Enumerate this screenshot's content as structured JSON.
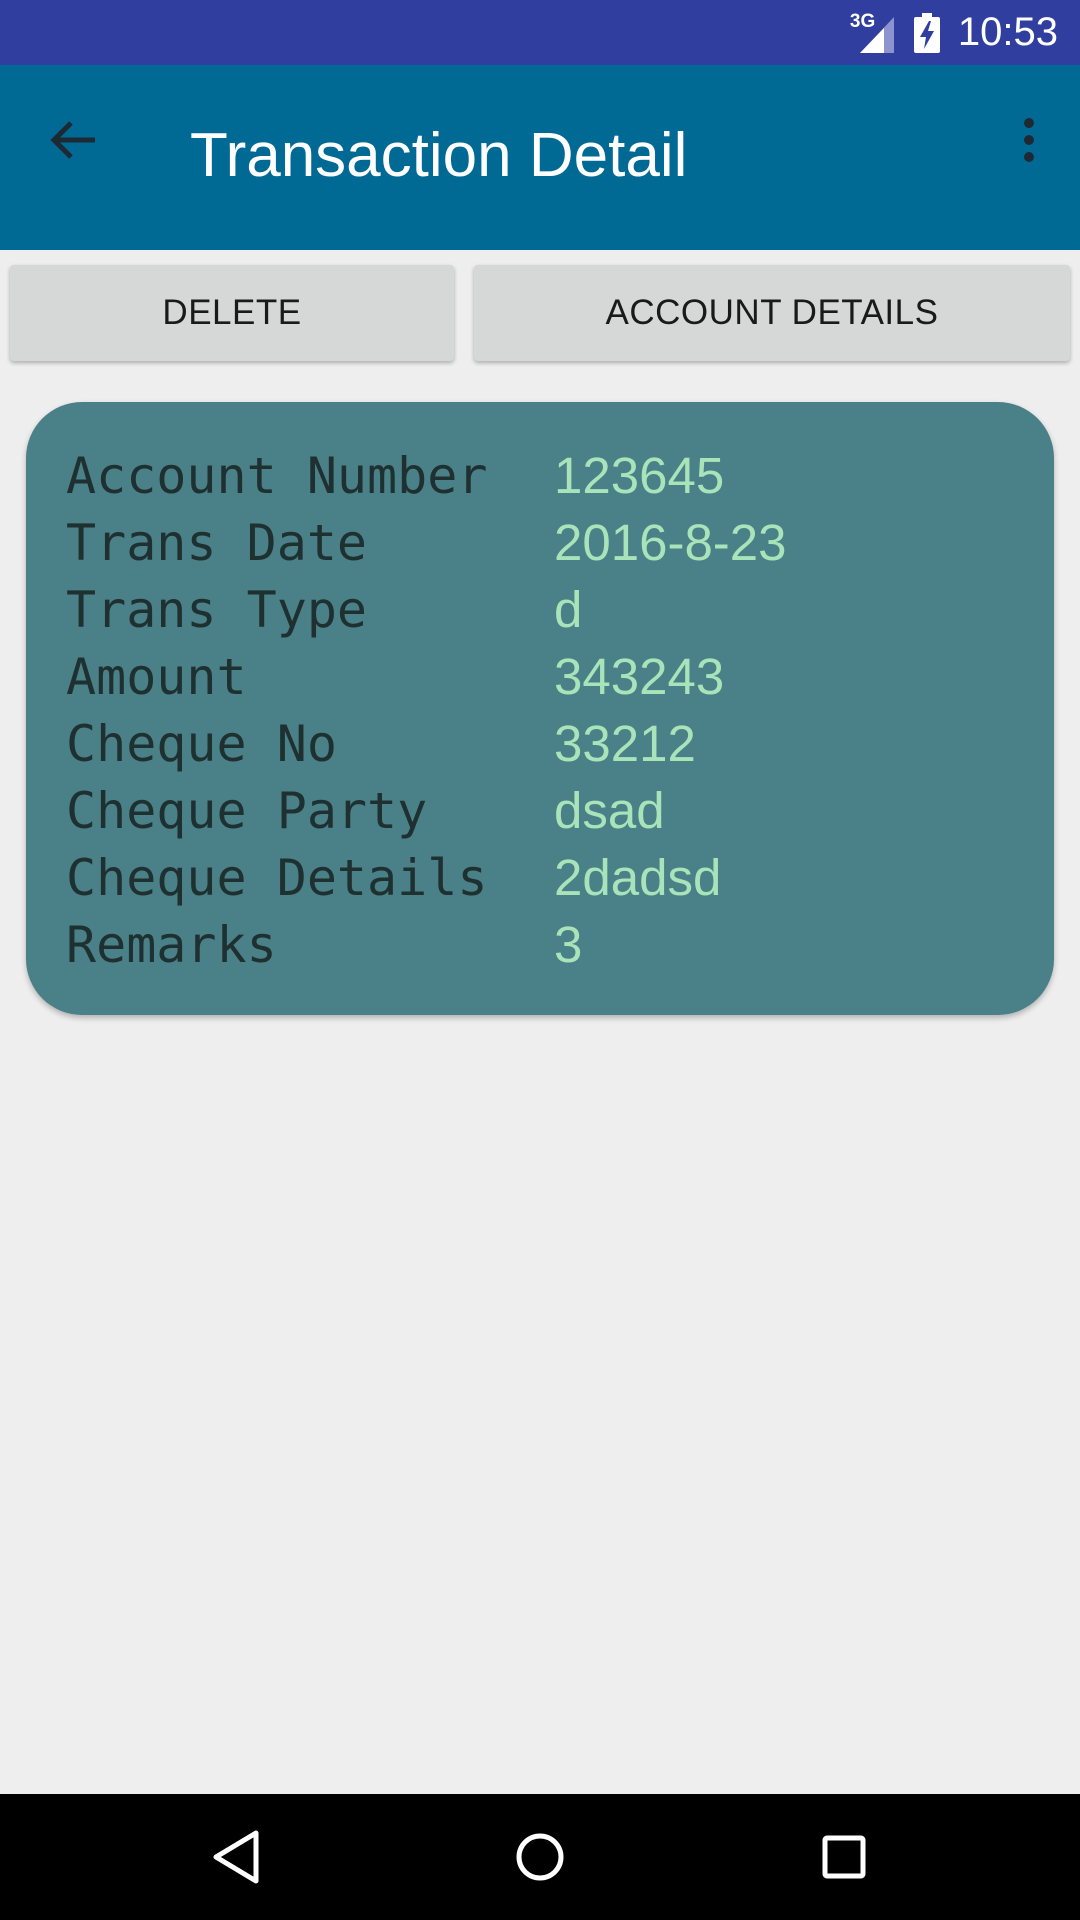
{
  "status_bar": {
    "network_label": "3G",
    "time": "10:53",
    "icons": [
      "signal-icon",
      "battery-charging-icon"
    ]
  },
  "app_bar": {
    "title": "Transaction Detail",
    "icons": [
      "back-arrow-icon",
      "overflow-menu-icon"
    ],
    "background_color": "#006a94"
  },
  "actions": {
    "delete_label": "DELETE",
    "account_details_label": "ACCOUNT DETAILS"
  },
  "details": {
    "rows": [
      {
        "label": "Account Number",
        "value": "123645"
      },
      {
        "label": "Trans Date",
        "value": "2016-8-23"
      },
      {
        "label": "Trans Type",
        "value": "d"
      },
      {
        "label": "Amount",
        "value": "343243"
      },
      {
        "label": "Cheque No",
        "value": "33212"
      },
      {
        "label": "Cheque Party",
        "value": "dsad"
      },
      {
        "label": "Cheque Details",
        "value": "2dadsd"
      },
      {
        "label": "Remarks",
        "value": "3"
      }
    ],
    "card_color": "#4a8087",
    "label_color": "#1f3030",
    "value_color": "#a9e3b9"
  },
  "nav_bar": {
    "icons": [
      "nav-back-icon",
      "nav-home-icon",
      "nav-recents-icon"
    ]
  },
  "colors": {
    "status_bar": "#303f9f",
    "page_background": "#eeeeee",
    "button_background": "#d6d7d7"
  }
}
